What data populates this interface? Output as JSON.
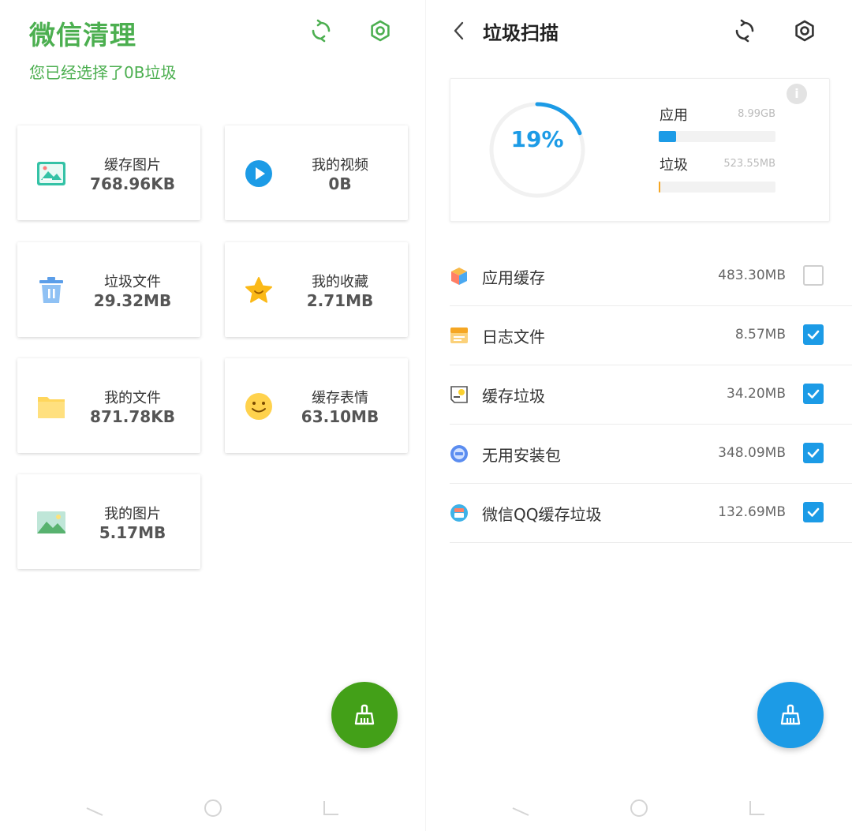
{
  "left": {
    "title": "微信清理",
    "subtitle": "您已经选择了0B垃圾",
    "icons": {
      "refresh": "refresh-icon",
      "settings": "settings-icon"
    },
    "cards": [
      {
        "label": "缓存图片",
        "value": "768.96KB",
        "icon": "image-cache-icon"
      },
      {
        "label": "我的视频",
        "value": "0B",
        "icon": "play-icon"
      },
      {
        "label": "垃圾文件",
        "value": "29.32MB",
        "icon": "trash-icon"
      },
      {
        "label": "我的收藏",
        "value": "2.71MB",
        "icon": "star-icon"
      },
      {
        "label": "我的文件",
        "value": "871.78KB",
        "icon": "folder-icon"
      },
      {
        "label": "缓存表情",
        "value": "63.10MB",
        "icon": "smiley-icon"
      },
      {
        "label": "我的图片",
        "value": "5.17MB",
        "icon": "picture-icon"
      }
    ],
    "fab_color": "#43a018"
  },
  "right": {
    "title": "垃圾扫描",
    "summary": {
      "percent_text": "19%",
      "percent": 19,
      "app_label": "应用",
      "app_value": "8.99GB",
      "app_fraction": 0.15,
      "junk_label": "垃圾",
      "junk_value": "523.55MB",
      "junk_fraction": 0.01
    },
    "items": [
      {
        "label": "应用缓存",
        "size": "483.30MB",
        "checked": false,
        "icon": "cube-icon"
      },
      {
        "label": "日志文件",
        "size": "8.57MB",
        "checked": true,
        "icon": "log-icon"
      },
      {
        "label": "缓存垃圾",
        "size": "34.20MB",
        "checked": true,
        "icon": "cache-junk-icon"
      },
      {
        "label": "无用安装包",
        "size": "348.09MB",
        "checked": true,
        "icon": "package-icon"
      },
      {
        "label": "微信QQ缓存垃圾",
        "size": "132.69MB",
        "checked": true,
        "icon": "chat-cache-icon"
      }
    ],
    "fab_color": "#1c9be6"
  },
  "colors": {
    "green": "#4caf50",
    "blue": "#1c9be6",
    "orange": "#f5a623"
  }
}
